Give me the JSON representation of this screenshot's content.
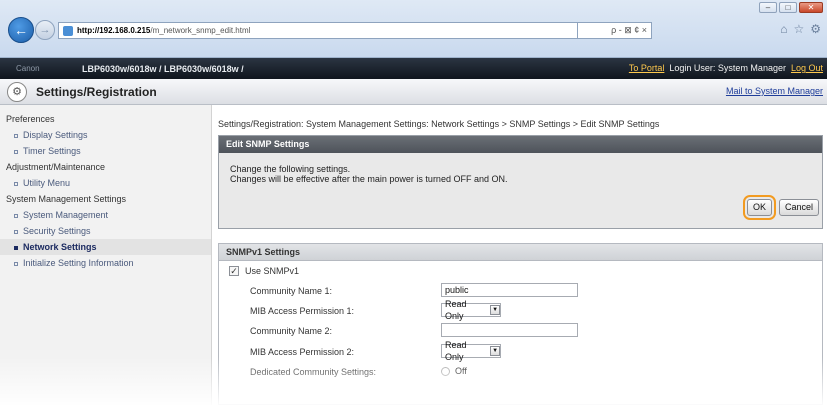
{
  "browser": {
    "url_host": "http://192.168.0.215",
    "url_path": "/m_network_snmp_edit.html",
    "addr_tools": "ρ - ⊠ ¢ ×",
    "win_min": "–",
    "win_max": "□",
    "win_close": "✕",
    "back_icon": "arrow-left",
    "fwd_icon": "arrow-right",
    "toolbar_icons": [
      "home-icon",
      "star-icon",
      "gear-icon"
    ]
  },
  "header": {
    "brand": "Canon",
    "device": "LBP6030w/6018w / LBP6030w/6018w /",
    "to_portal": "To Portal",
    "login_label": "Login User: System Manager",
    "logout": "Log Out",
    "page_title": "Settings/Registration",
    "mail": "Mail to System Manager"
  },
  "sidebar": {
    "groups": [
      {
        "label": "Preferences"
      },
      {
        "label": "Adjustment/Maintenance"
      },
      {
        "label": "System Management Settings"
      }
    ],
    "items": [
      {
        "label": "Display Settings"
      },
      {
        "label": "Timer Settings"
      },
      {
        "label": "Utility Menu"
      },
      {
        "label": "System Management"
      },
      {
        "label": "Security Settings"
      },
      {
        "label": "Network Settings"
      },
      {
        "label": "Initialize Setting Information"
      }
    ]
  },
  "main": {
    "breadcrumb": "Settings/Registration: System Management Settings: Network Settings > SNMP Settings > Edit SNMP Settings",
    "panel_title": "Edit SNMP Settings",
    "panel_line1": "Change the following settings.",
    "panel_line2": "Changes will be effective after the main power is turned OFF and ON.",
    "ok_label": "OK",
    "cancel_label": "Cancel",
    "section_title": "SNMPv1 Settings",
    "use_snmpv1": "Use SNMPv1",
    "community1_label": "Community Name 1:",
    "community1_value": "public",
    "mib1_label": "MIB Access Permission 1:",
    "mib1_value": "Read Only",
    "community2_label": "Community Name 2:",
    "community2_value": "",
    "mib2_label": "MIB Access Permission 2:",
    "mib2_value": "Read Only",
    "dedicated_label": "Dedicated Community Settings:",
    "dedicated_value": "Off"
  },
  "colors": {
    "highlight": "#f29b21",
    "header_dark": "#1a212b",
    "link": "#1f3d9a"
  }
}
